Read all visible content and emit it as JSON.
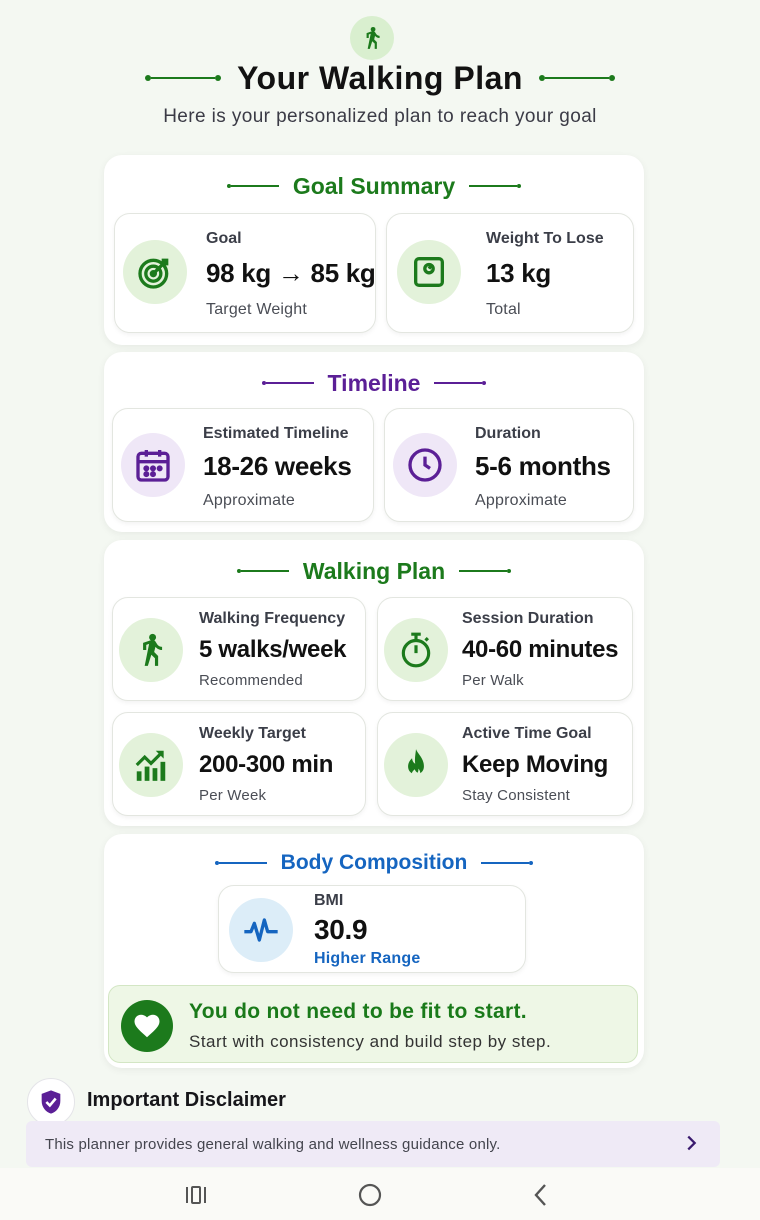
{
  "header": {
    "title": "Your Walking Plan",
    "subtitle": "Here is your personalized plan to reach your goal"
  },
  "goal_summary": {
    "title": "Goal Summary",
    "cards": [
      {
        "label": "Goal",
        "value": "98 kg → 85 kg",
        "sub": "Target Weight",
        "icon": "target-icon"
      },
      {
        "label": "Weight To Lose",
        "value": "13 kg",
        "sub": "Total",
        "icon": "scale-icon"
      }
    ]
  },
  "timeline": {
    "title": "Timeline",
    "cards": [
      {
        "label": "Estimated Timeline",
        "value": "18-26 weeks",
        "sub": "Approximate",
        "icon": "calendar-icon"
      },
      {
        "label": "Duration",
        "value": "5-6 months",
        "sub": "Approximate",
        "icon": "clock-icon"
      }
    ]
  },
  "walking_plan": {
    "title": "Walking Plan",
    "cards": [
      {
        "label": "Walking Frequency",
        "value": "5 walks/week",
        "sub": "Recommended",
        "icon": "walking-person-icon"
      },
      {
        "label": "Session Duration",
        "value": "40-60 minutes",
        "sub": "Per Walk",
        "icon": "stopwatch-icon"
      },
      {
        "label": "Weekly Target",
        "value": "200-300 min",
        "sub": "Per Week",
        "icon": "trending-chart-icon"
      },
      {
        "label": "Active Time Goal",
        "value": "Keep Moving",
        "sub": "Stay Consistent",
        "icon": "flame-icon"
      }
    ]
  },
  "body_composition": {
    "title": "Body Composition",
    "bmi": {
      "label": "BMI",
      "value": "30.9",
      "sub": "Higher Range",
      "icon": "pulse-icon"
    }
  },
  "banner": {
    "headline": "You do not need to be fit to start.",
    "text": "Start with consistency and build step by step."
  },
  "disclaimer": {
    "title": "Important Disclaimer",
    "text": "This planner provides general walking and wellness guidance only."
  },
  "colors": {
    "green": "#1c7a1c",
    "purple": "#5b1f96",
    "blue": "#1565c0"
  }
}
